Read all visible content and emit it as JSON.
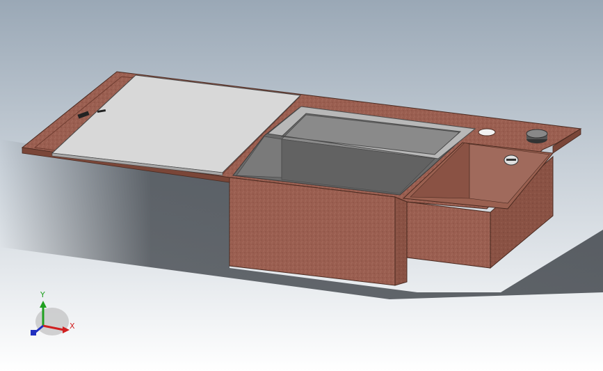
{
  "viewport": {
    "background_top": "#9aa8b6",
    "background_bottom": "#ffffff"
  },
  "model": {
    "body_color": "#9a5e50",
    "body_shade": "#7a4638",
    "basin_color": "#8a8a8a",
    "cover_color": "#d8d8d8",
    "steel_color": "#a8a8a8"
  },
  "triad": {
    "x_label": "X",
    "y_label": "Y",
    "x_color": "#d02020",
    "y_color": "#20a020",
    "z_color": "#2030c0"
  }
}
